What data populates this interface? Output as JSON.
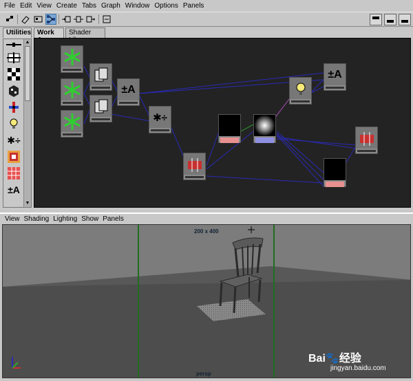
{
  "menubar": {
    "items": [
      "File",
      "Edit",
      "View",
      "Create",
      "Tabs",
      "Graph",
      "Window",
      "Options",
      "Panels"
    ]
  },
  "tabs": {
    "utilities": "Utilities",
    "work_area": "Work Area",
    "shader_library": "Shader Library"
  },
  "view_menu": {
    "items": [
      "View",
      "Shading",
      "Lighting",
      "Show",
      "Panels"
    ]
  },
  "viewport": {
    "resolution": "200 x 400",
    "camera": "persp"
  },
  "watermark": {
    "brand": "Bai",
    "brand_suffix": "经验",
    "url": "jingyan.baidu.com"
  },
  "icons": {
    "utility_math_symbol": "±A",
    "multiply_divide_symbol": "✱÷"
  },
  "colors": {
    "graph_bg": "#232323",
    "connection": "#2a2ab8",
    "connection_green": "#2fa62f",
    "connection_magenta": "#b050c0",
    "selected_tool": "#7aa6d6",
    "node_red_footer": "#e89090",
    "node_blue_footer": "#9090e0",
    "safe_frame": "#1f6e1f"
  }
}
